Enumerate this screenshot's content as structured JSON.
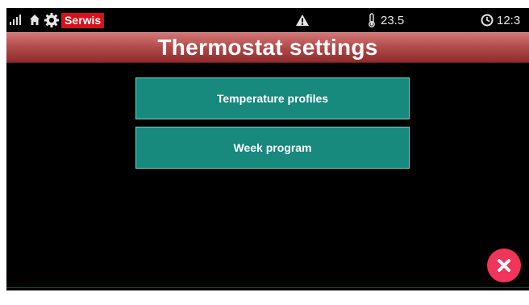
{
  "status_bar": {
    "signal_icon": "signal-bars-icon",
    "home_icon": "home-icon",
    "gear_icon": "gear-icon",
    "mode_badge": "Serwis",
    "warning_icon": "warning-triangle-icon",
    "thermometer_icon": "thermometer-icon",
    "temperature": "23.5",
    "clock_icon": "clock-icon",
    "time": "12:3"
  },
  "header": {
    "title": "Thermostat settings"
  },
  "menu": {
    "items": [
      {
        "label": "Temperature profiles"
      },
      {
        "label": "Week program"
      }
    ]
  },
  "close_button": {
    "icon": "close-icon",
    "color": "#f0345a"
  },
  "colors": {
    "background": "#000000",
    "title_bar": "#b44e4e",
    "button_fill": "#17897d",
    "button_border": "#7bd1c6",
    "badge": "#d8121a"
  }
}
